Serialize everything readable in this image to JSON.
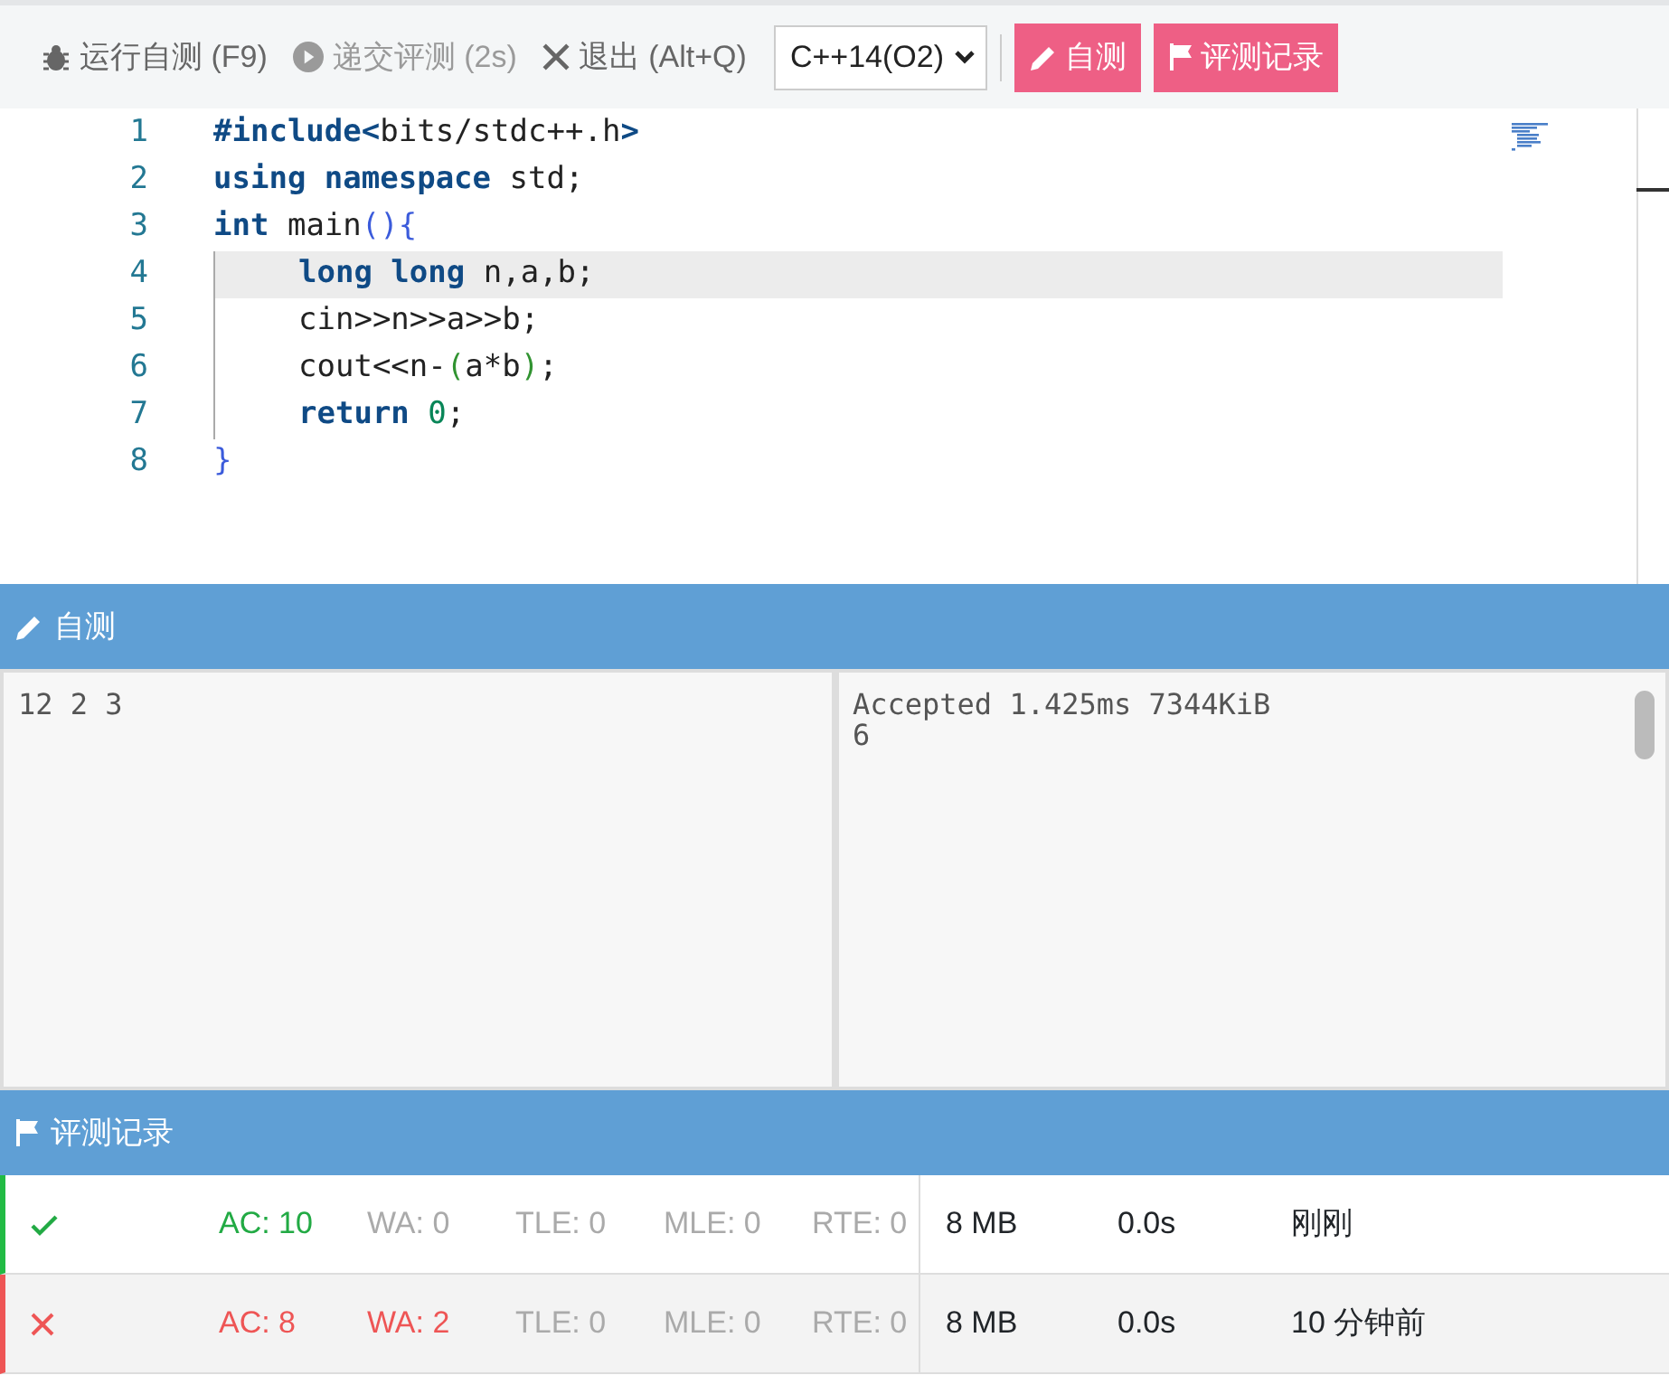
{
  "toolbar": {
    "buttons": [
      {
        "label": "运行自测 (F9)",
        "kind": "bug",
        "disabled": false
      },
      {
        "label": "递交评测 (2s)",
        "kind": "play",
        "disabled": true
      },
      {
        "label": "退出 (Alt+Q)",
        "kind": "close",
        "disabled": false
      }
    ],
    "language": "C++14(O2)",
    "actions": [
      {
        "label": "自测",
        "kind": "pencil"
      },
      {
        "label": "评测记录",
        "kind": "flag"
      }
    ]
  },
  "editor": {
    "lines": [
      {
        "number": "1",
        "indented": false,
        "current": false,
        "tokens": [
          {
            "t": "#include",
            "kind": "keyword"
          },
          {
            "t": "<",
            "kind": "keyword"
          },
          {
            "t": "bits/stdc++.h",
            "kind": "plain"
          },
          {
            "t": ">",
            "kind": "keyword"
          }
        ]
      },
      {
        "number": "2",
        "indented": false,
        "current": false,
        "tokens": [
          {
            "t": "using namespace",
            "kind": "keyword"
          },
          {
            "t": " std;",
            "kind": "plain"
          }
        ]
      },
      {
        "number": "3",
        "indented": false,
        "current": false,
        "tokens": [
          {
            "t": "int",
            "kind": "keyword"
          },
          {
            "t": " main",
            "kind": "plain"
          },
          {
            "t": "(){",
            "kind": "bracket"
          }
        ]
      },
      {
        "number": "4",
        "indented": true,
        "current": true,
        "tokens": [
          {
            "t": "long long",
            "kind": "keyword"
          },
          {
            "t": " n,a,b;",
            "kind": "plain"
          }
        ]
      },
      {
        "number": "5",
        "indented": true,
        "current": false,
        "tokens": [
          {
            "t": "cin>>n>>a>>b;",
            "kind": "plain"
          }
        ]
      },
      {
        "number": "6",
        "indented": true,
        "current": false,
        "tokens": [
          {
            "t": "cout<<n-",
            "kind": "plain"
          },
          {
            "t": "(",
            "kind": "paren"
          },
          {
            "t": "a*b",
            "kind": "plain"
          },
          {
            "t": ")",
            "kind": "paren"
          },
          {
            "t": ";",
            "kind": "plain"
          }
        ]
      },
      {
        "number": "7",
        "indented": true,
        "current": false,
        "tokens": [
          {
            "t": "return ",
            "kind": "keyword"
          },
          {
            "t": "0",
            "kind": "number"
          },
          {
            "t": ";",
            "kind": "plain"
          }
        ]
      },
      {
        "number": "8",
        "indented": false,
        "current": false,
        "tokens": [
          {
            "t": "}",
            "kind": "bracket"
          }
        ]
      }
    ]
  },
  "selftest": {
    "title": "自测",
    "input": "12 2 3",
    "output": "Accepted 1.425ms 7344KiB\n6"
  },
  "records": {
    "title": "评测记录",
    "rows": [
      {
        "kind": "accepted",
        "counts": [
          {
            "text": "AC: 10",
            "color": "#22aa44"
          },
          {
            "text": "WA: 0",
            "color": "#aaaaaa"
          },
          {
            "text": "TLE: 0",
            "color": "#aaaaaa"
          },
          {
            "text": "MLE: 0",
            "color": "#aaaaaa"
          },
          {
            "text": "RTE: 0",
            "color": "#aaaaaa"
          }
        ],
        "memory": "8 MB",
        "time": "0.0s",
        "when": "刚刚"
      },
      {
        "kind": "rejected",
        "counts": [
          {
            "text": "AC: 8",
            "color": "#ee5555"
          },
          {
            "text": "WA: 2",
            "color": "#ee5555"
          },
          {
            "text": "TLE: 0",
            "color": "#aaaaaa"
          },
          {
            "text": "MLE: 0",
            "color": "#aaaaaa"
          },
          {
            "text": "RTE: 0",
            "color": "#aaaaaa"
          }
        ],
        "memory": "8 MB",
        "time": "0.0s",
        "when": "10 分钟前"
      }
    ]
  }
}
